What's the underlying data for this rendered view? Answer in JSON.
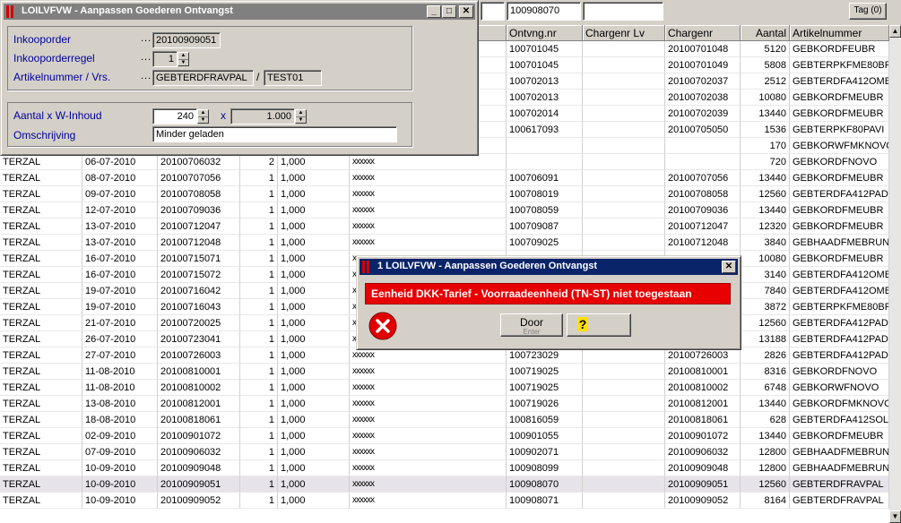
{
  "toolbar": {
    "field_1": "",
    "field_2": "100908070",
    "field_3": "",
    "tag_label": "Tag (0)"
  },
  "grid": {
    "columns": [
      "Ontvng.nr",
      "Chargenr Lv",
      "Chargenr",
      "Aantal",
      "Artikelnummer"
    ],
    "rows": [
      {
        "c1": "",
        "c2": "",
        "c3": "",
        "c4": "",
        "c5": "",
        "ontvng": "100701045",
        "lv": "",
        "charge": "20100701048",
        "aantal": "5120",
        "artikel": "GEBKORDFEUBR",
        "mask": ""
      },
      {
        "c1": "",
        "c2": "",
        "c3": "",
        "c4": "",
        "c5": "",
        "ontvng": "100701045",
        "lv": "",
        "charge": "20100701049",
        "aantal": "5808",
        "artikel": "GEBTERPKFME80BR",
        "mask": ""
      },
      {
        "c1": "",
        "c2": "",
        "c3": "",
        "c4": "",
        "c5": "",
        "ontvng": "100702013",
        "lv": "",
        "charge": "20100702037",
        "aantal": "2512",
        "artikel": "GEBTERDFA412OMB",
        "mask": ""
      },
      {
        "c1": "",
        "c2": "",
        "c3": "",
        "c4": "",
        "c5": "",
        "ontvng": "100702013",
        "lv": "",
        "charge": "20100702038",
        "aantal": "10080",
        "artikel": "GEBKORDFMEUBR",
        "mask": ""
      },
      {
        "c1": "",
        "c2": "",
        "c3": "",
        "c4": "",
        "c5": "",
        "ontvng": "100702014",
        "lv": "",
        "charge": "20100702039",
        "aantal": "13440",
        "artikel": "GEBKORDFMEUBR",
        "mask": ""
      },
      {
        "c1": "",
        "c2": "",
        "c3": "",
        "c4": "",
        "c5": "",
        "ontvng": "100617093",
        "lv": "",
        "charge": "20100705050",
        "aantal": "1536",
        "artikel": "GEBTERPKF80PAVI",
        "mask": ""
      },
      {
        "c1": "",
        "c2": "",
        "c3": "",
        "c4": "",
        "c5": "",
        "ontvng": "",
        "lv": "",
        "charge": "",
        "aantal": "170",
        "artikel": "GEBKORWFMKNOVO",
        "mask": ""
      },
      {
        "c1": "TERZAL",
        "c2": "06-07-2010",
        "c3": "20100706032",
        "c4": "2",
        "c5": "1,000",
        "ontvng": "",
        "lv": "",
        "charge": "",
        "aantal": "720",
        "artikel": "GEBKORDFNOVO",
        "mask": "xxxxxx"
      },
      {
        "c1": "TERZAL",
        "c2": "08-07-2010",
        "c3": "20100707056",
        "c4": "1",
        "c5": "1,000",
        "ontvng": "100706091",
        "lv": "",
        "charge": "20100707056",
        "aantal": "13440",
        "artikel": "GEBKORDFMEUBR",
        "mask": "xxxxxx"
      },
      {
        "c1": "TERZAL",
        "c2": "09-07-2010",
        "c3": "20100708058",
        "c4": "1",
        "c5": "1,000",
        "ontvng": "100708019",
        "lv": "",
        "charge": "20100708058",
        "aantal": "12560",
        "artikel": "GEBTERDFA412PAD",
        "mask": "xxxxxx"
      },
      {
        "c1": "TERZAL",
        "c2": "12-07-2010",
        "c3": "20100709036",
        "c4": "1",
        "c5": "1,000",
        "ontvng": "100708059",
        "lv": "",
        "charge": "20100709036",
        "aantal": "13440",
        "artikel": "GEBKORDFMEUBR",
        "mask": "xxxxxx"
      },
      {
        "c1": "TERZAL",
        "c2": "13-07-2010",
        "c3": "20100712047",
        "c4": "1",
        "c5": "1,000",
        "ontvng": "100709087",
        "lv": "",
        "charge": "20100712047",
        "aantal": "12320",
        "artikel": "GEBKORDFMEUBR",
        "mask": "xxxxxx"
      },
      {
        "c1": "TERZAL",
        "c2": "13-07-2010",
        "c3": "20100712048",
        "c4": "1",
        "c5": "1,000",
        "ontvng": "100709025",
        "lv": "",
        "charge": "20100712048",
        "aantal": "3840",
        "artikel": "GEBHAADFMEBRUN",
        "mask": "xxxxxx"
      },
      {
        "c1": "TERZAL",
        "c2": "16-07-2010",
        "c3": "20100715071",
        "c4": "1",
        "c5": "1,000",
        "ontvng": "",
        "lv": "",
        "charge": "",
        "aantal": "10080",
        "artikel": "GEBKORDFMEUBR",
        "mask": "x"
      },
      {
        "c1": "TERZAL",
        "c2": "16-07-2010",
        "c3": "20100715072",
        "c4": "1",
        "c5": "1,000",
        "ontvng": "",
        "lv": "",
        "charge": "",
        "aantal": "3140",
        "artikel": "GEBTERDFA412OMB",
        "mask": "x"
      },
      {
        "c1": "TERZAL",
        "c2": "19-07-2010",
        "c3": "20100716042",
        "c4": "1",
        "c5": "1,000",
        "ontvng": "",
        "lv": "",
        "charge": "",
        "aantal": "7840",
        "artikel": "GEBTERDFA412OMB",
        "mask": "x"
      },
      {
        "c1": "TERZAL",
        "c2": "19-07-2010",
        "c3": "20100716043",
        "c4": "1",
        "c5": "1,000",
        "ontvng": "",
        "lv": "",
        "charge": "",
        "aantal": "3872",
        "artikel": "GEBTERPKFME80BR",
        "mask": "x"
      },
      {
        "c1": "TERZAL",
        "c2": "21-07-2010",
        "c3": "20100720025",
        "c4": "1",
        "c5": "1,000",
        "ontvng": "",
        "lv": "",
        "charge": "",
        "aantal": "12560",
        "artikel": "GEBTERDFA412PAD",
        "mask": "x"
      },
      {
        "c1": "TERZAL",
        "c2": "26-07-2010",
        "c3": "20100723041",
        "c4": "1",
        "c5": "1,000",
        "ontvng": "",
        "lv": "",
        "charge": "",
        "aantal": "13188",
        "artikel": "GEBTERDFA412PAD",
        "mask": "x"
      },
      {
        "c1": "TERZAL",
        "c2": "27-07-2010",
        "c3": "20100726003",
        "c4": "1",
        "c5": "1,000",
        "ontvng": "100723029",
        "lv": "",
        "charge": "20100726003",
        "aantal": "2826",
        "artikel": "GEBTERDFA412PAD",
        "mask": "xxxxxx"
      },
      {
        "c1": "TERZAL",
        "c2": "11-08-2010",
        "c3": "20100810001",
        "c4": "1",
        "c5": "1,000",
        "ontvng": "100719025",
        "lv": "",
        "charge": "20100810001",
        "aantal": "8316",
        "artikel": "GEBKORDFNOVO",
        "mask": "xxxxxx"
      },
      {
        "c1": "TERZAL",
        "c2": "11-08-2010",
        "c3": "20100810002",
        "c4": "1",
        "c5": "1,000",
        "ontvng": "100719025",
        "lv": "",
        "charge": "20100810002",
        "aantal": "6748",
        "artikel": "GEBKORWFNOVO",
        "mask": "xxxxxx"
      },
      {
        "c1": "TERZAL",
        "c2": "13-08-2010",
        "c3": "20100812001",
        "c4": "1",
        "c5": "1,000",
        "ontvng": "100719026",
        "lv": "",
        "charge": "20100812001",
        "aantal": "13440",
        "artikel": "GEBKORDFMKNOVO",
        "mask": "xxxxxx"
      },
      {
        "c1": "TERZAL",
        "c2": "18-08-2010",
        "c3": "20100818061",
        "c4": "1",
        "c5": "1,000",
        "ontvng": "100816059",
        "lv": "",
        "charge": "20100818061",
        "aantal": "628",
        "artikel": "GEBTERDFA412SOL",
        "mask": "xxxxxx"
      },
      {
        "c1": "TERZAL",
        "c2": "02-09-2010",
        "c3": "20100901072",
        "c4": "1",
        "c5": "1,000",
        "ontvng": "100901055",
        "lv": "",
        "charge": "20100901072",
        "aantal": "13440",
        "artikel": "GEBKORDFMEUBR",
        "mask": "xxxxxx"
      },
      {
        "c1": "TERZAL",
        "c2": "07-09-2010",
        "c3": "20100906032",
        "c4": "1",
        "c5": "1,000",
        "ontvng": "100902071",
        "lv": "",
        "charge": "20100906032",
        "aantal": "12800",
        "artikel": "GEBHAADFMEBRUN",
        "mask": "xxxxxx"
      },
      {
        "c1": "TERZAL",
        "c2": "10-09-2010",
        "c3": "20100909048",
        "c4": "1",
        "c5": "1,000",
        "ontvng": "100908099",
        "lv": "",
        "charge": "20100909048",
        "aantal": "12800",
        "artikel": "GEBHAADFMEBRUN",
        "mask": "xxxxxx"
      },
      {
        "c1": "TERZAL",
        "c2": "10-09-2010",
        "c3": "20100909051",
        "c4": "1",
        "c5": "1,000",
        "ontvng": "100908070",
        "lv": "",
        "charge": "20100909051",
        "aantal": "12560",
        "artikel": "GEBTERDFRAVPAL",
        "mask": "xxxxxx",
        "selected": true
      },
      {
        "c1": "TERZAL",
        "c2": "10-09-2010",
        "c3": "20100909052",
        "c4": "1",
        "c5": "1,000",
        "ontvng": "100908071",
        "lv": "",
        "charge": "20100909052",
        "aantal": "8164",
        "artikel": "GEBTERDFRAVPAL",
        "mask": "xxxxxx"
      }
    ]
  },
  "form_window": {
    "title": "LOILVFVW - Aanpassen Goederen Ontvangst",
    "inkooporder_label": "Inkooporder",
    "inkooporder_value": "20100909051",
    "inkooporderregel_label": "Inkooporderregel",
    "inkooporderregel_value": "1",
    "artikel_label": "Artikelnummer / Vrs.",
    "artikel_value": "GEBTERDFRAVPAL",
    "separator": "/",
    "versie_value": "TEST01",
    "aantal_label": "Aantal x W-Inhoud",
    "aantal_value": "240",
    "x_label": "x",
    "inhoud_value": "1.000",
    "omschrijving_label": "Omschrijving",
    "omschrijving_value": "Minder geladen",
    "dots": "..."
  },
  "error_dialog": {
    "title": "1 LOILVFVW - Aanpassen Goederen Ontvangst",
    "message": "Eenheid DKK-Tarief - Voorraadeenheid (TN-ST) niet toegestaan",
    "door_label": "Door",
    "enter_hint": "Enter",
    "help_glyph": "?"
  },
  "colors": {
    "titlebar_active": "#0a246a",
    "titlebar_inactive": "#808080",
    "label_blue": "#0000a0",
    "error_red": "#e80000",
    "selected_row": "#e6e3ea"
  }
}
